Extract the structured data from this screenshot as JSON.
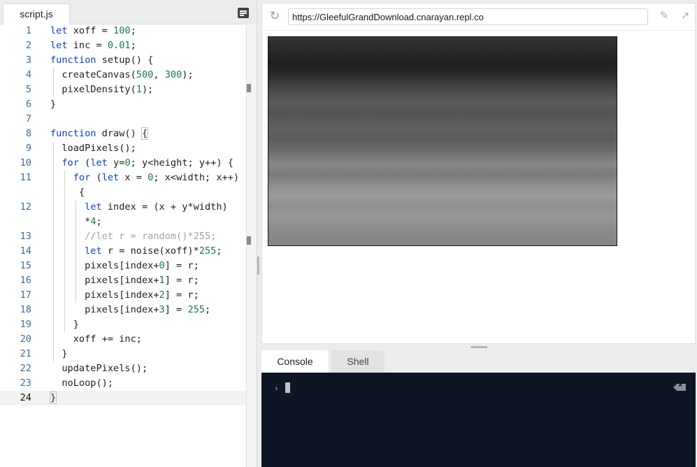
{
  "editor": {
    "tab_label": "script.js",
    "files_icon": "files-icon",
    "current_line": 24,
    "lines": [
      {
        "n": "1",
        "html": "<span class=\"kw\">let</span> xoff = <span class=\"nm\">100</span>;"
      },
      {
        "n": "2",
        "html": "<span class=\"kw\">let</span> inc = <span class=\"nm\">0.01</span>;"
      },
      {
        "n": "3",
        "html": "<span class=\"kw\">function</span> setup() {"
      },
      {
        "n": "4",
        "html": "  createCanvas(<span class=\"nm\">500</span>, <span class=\"nm\">300</span>);"
      },
      {
        "n": "5",
        "html": "  pixelDensity(<span class=\"nm\">1</span>);"
      },
      {
        "n": "6",
        "html": "}"
      },
      {
        "n": "7",
        "html": ""
      },
      {
        "n": "8",
        "html": "<span class=\"kw\">function</span> draw() <span class=\"brk\">{</span>"
      },
      {
        "n": "9",
        "html": "  loadPixels();"
      },
      {
        "n": "10",
        "html": "  <span class=\"kw\">for</span> (<span class=\"kw\">let</span> y=<span class=\"nm\">0</span>; y&lt;height; y++) {"
      },
      {
        "n": "11",
        "html": "    <span class=\"kw\">for</span> (<span class=\"kw\">let</span> x = <span class=\"nm\">0</span>; x&lt;width; x++)"
      },
      {
        "n": "",
        "html": "     {"
      },
      {
        "n": "12",
        "html": "      <span class=\"kw\">let</span> index = (x + y*width)"
      },
      {
        "n": "",
        "html": "      *<span class=\"nm\">4</span>;"
      },
      {
        "n": "13",
        "html": "      <span class=\"cm\">//let r = random()*255;</span>"
      },
      {
        "n": "14",
        "html": "      <span class=\"kw\">let</span> r = noise(xoff)*<span class=\"nm\">255</span>;"
      },
      {
        "n": "15",
        "html": "      pixels[index+<span class=\"nm\">0</span>] = r;"
      },
      {
        "n": "16",
        "html": "      pixels[index+<span class=\"nm\">1</span>] = r;"
      },
      {
        "n": "17",
        "html": "      pixels[index+<span class=\"nm\">2</span>] = r;"
      },
      {
        "n": "18",
        "html": "      pixels[index+<span class=\"nm\">3</span>] = <span class=\"nm\">255</span>;"
      },
      {
        "n": "19",
        "html": "    }"
      },
      {
        "n": "20",
        "html": "    xoff += inc;"
      },
      {
        "n": "21",
        "html": "  }"
      },
      {
        "n": "22",
        "html": "  updatePixels();"
      },
      {
        "n": "23",
        "html": "  noLoop();"
      },
      {
        "n": "24",
        "html": "<span class=\"brk\">}</span>"
      }
    ]
  },
  "browser": {
    "url": "https://GleefulGrandDownload.cnarayan.repl.co",
    "reload_icon": "reload-icon",
    "edit_icon": "pencil-icon",
    "open_icon": "open-in-new-tab-icon"
  },
  "console": {
    "tabs": [
      "Console",
      "Shell"
    ],
    "active_tab": "Console",
    "prompt_icon": "prompt-chevron-icon",
    "clear_icon": "clear-console-icon"
  },
  "colors": {
    "keyword": "#0b3fd1",
    "number": "#177a4c",
    "comment": "#a3a3a3",
    "line_number": "#3c6d9e",
    "console_bg": "#0e1525",
    "prompt": "#f5c33b"
  }
}
